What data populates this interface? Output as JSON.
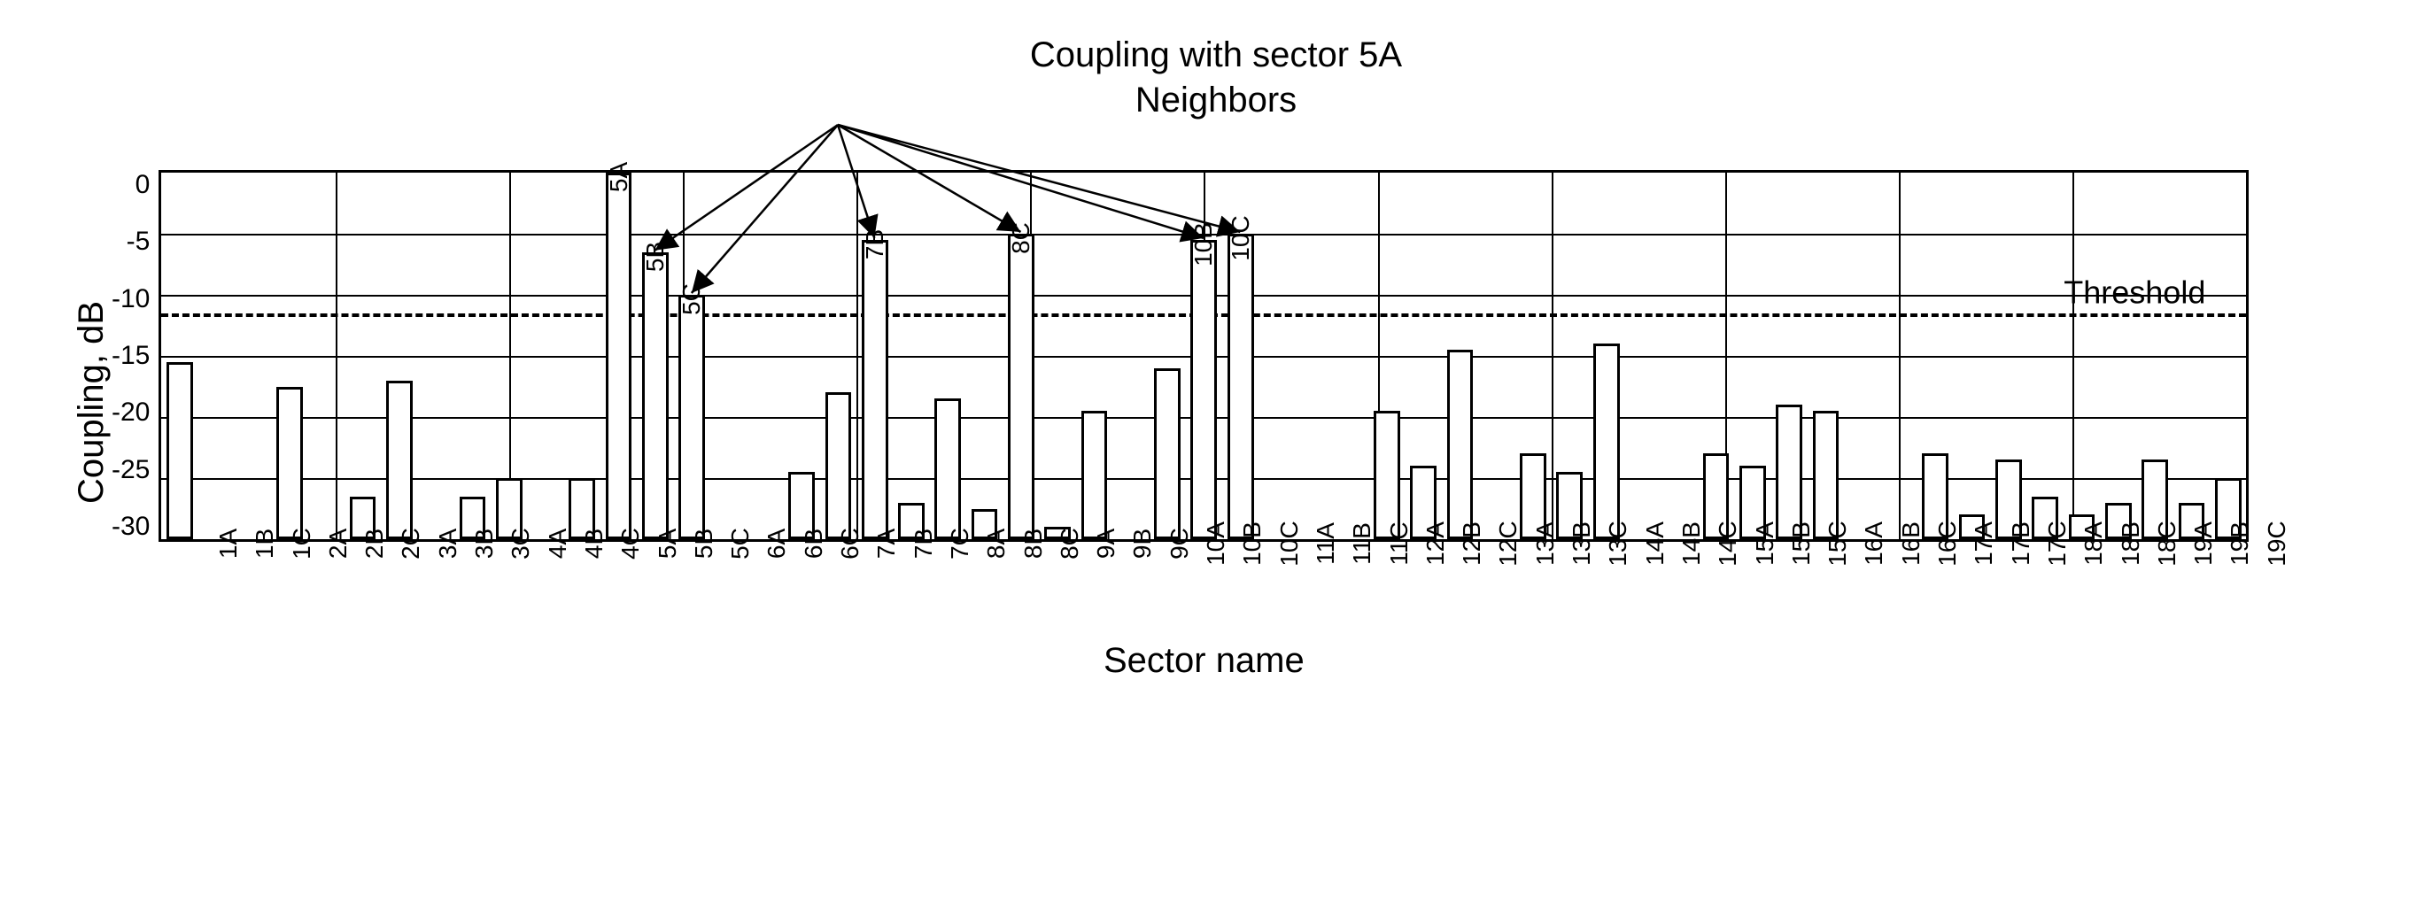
{
  "title": "Coupling with sector 5A",
  "subtitle": "Neighbors",
  "ylabel": "Coupling, dB",
  "xlabel": "Sector name",
  "threshold_label": "Threshold",
  "yticks": [
    "0",
    "-5",
    "-10",
    "-15",
    "-20",
    "-25",
    "-30"
  ],
  "chart_data": {
    "type": "bar",
    "ylim": [
      -30,
      0
    ],
    "threshold": -11.5,
    "ylabel": "Coupling, dB",
    "xlabel": "Sector name",
    "title": "Coupling with sector 5A",
    "neighbors": [
      "5B",
      "5C",
      "7B",
      "8C",
      "10B",
      "10C"
    ],
    "neighbor_origin": "5A",
    "categories": [
      "1A",
      "1B",
      "1C",
      "2A",
      "2B",
      "2C",
      "3A",
      "3B",
      "3C",
      "4A",
      "4B",
      "4C",
      "5A",
      "5B",
      "5C",
      "6A",
      "6B",
      "6C",
      "7A",
      "7B",
      "7C",
      "8A",
      "8B",
      "8C",
      "9A",
      "9B",
      "9C",
      "10A",
      "10B",
      "10C",
      "11A",
      "11B",
      "11C",
      "12A",
      "12B",
      "12C",
      "13A",
      "13B",
      "13C",
      "14A",
      "14B",
      "14C",
      "15A",
      "15B",
      "15C",
      "16A",
      "16B",
      "16C",
      "17A",
      "17B",
      "17C",
      "18A",
      "18B",
      "18C",
      "19A",
      "19B",
      "19C"
    ],
    "values": [
      -15.5,
      -30,
      -30,
      -17.5,
      -30,
      -26.5,
      -17.0,
      -30,
      -26.5,
      -25.0,
      -30,
      -25.0,
      0.0,
      -6.5,
      -10.0,
      -30,
      -30,
      -24.5,
      -18.0,
      -5.5,
      -27.0,
      -18.5,
      -27.5,
      -5.0,
      -29.0,
      -19.5,
      -30,
      -16.0,
      -5.5,
      -5.0,
      -30,
      -30,
      -30,
      -19.5,
      -24.0,
      -14.5,
      -30,
      -23.0,
      -24.5,
      -14.0,
      -30,
      -30,
      -23.0,
      -24.0,
      -19.0,
      -19.5,
      -30,
      -30,
      -23.0,
      -28.0,
      -23.5,
      -26.5,
      -28.0,
      -27.0,
      -23.5,
      -27.0,
      -25.0
    ],
    "bar_labels": {
      "12": "5A",
      "13": "5B",
      "14": "5C",
      "19": "7B",
      "23": "8C",
      "28": "10B",
      "29": "10C"
    }
  }
}
